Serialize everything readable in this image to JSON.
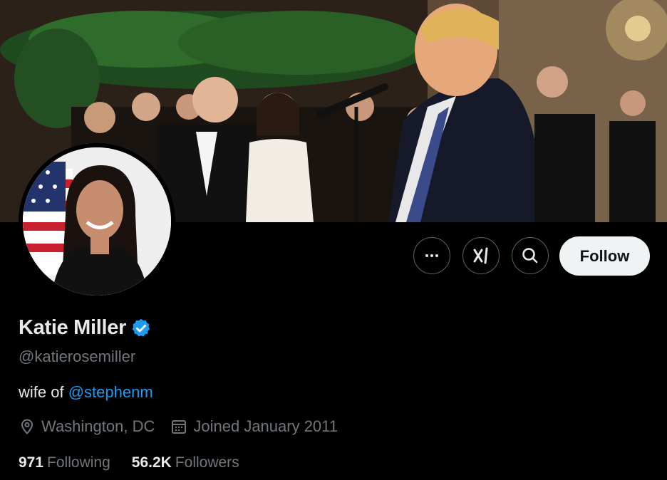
{
  "profile": {
    "name": "Katie Miller",
    "handle": "@katierosemiller",
    "bio_prefix": "wife of ",
    "bio_mention": "@stephenm",
    "location": "Washington, DC",
    "joined": "Joined January 2011",
    "following_count": "971",
    "following_label": "Following",
    "followers_count": "56.2K",
    "followers_label": "Followers"
  },
  "actions": {
    "follow_label": "Follow"
  },
  "icons": {
    "more": "more-icon",
    "grok": "grok-icon",
    "search": "search-icon",
    "verified": "verified-badge-icon",
    "location": "location-pin-icon",
    "calendar": "calendar-icon"
  },
  "colors": {
    "background": "#000000",
    "text_primary": "#e7e9ea",
    "text_secondary": "#71767b",
    "link": "#1d9bf0",
    "verified": "#1d9bf0",
    "follow_button_bg": "#eff3f4",
    "follow_button_text": "#0f1419",
    "button_border": "#536471"
  }
}
